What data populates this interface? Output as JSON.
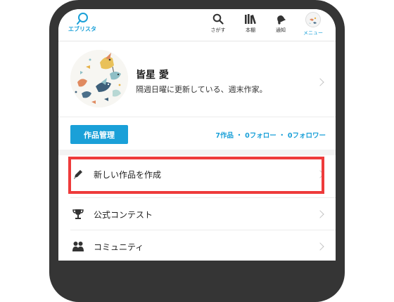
{
  "header": {
    "logo_label": "エブリスタ",
    "nav": [
      {
        "label": "さがす",
        "icon": "search-icon"
      },
      {
        "label": "本棚",
        "icon": "bookshelf-icon"
      },
      {
        "label": "通知",
        "icon": "bell-icon"
      },
      {
        "label": "メニュー",
        "icon": "avatar-icon"
      }
    ]
  },
  "profile": {
    "name": "皆星 愛",
    "bio": "隔週日曜に更新している、週末作家。"
  },
  "manage": {
    "button_label": "作品管理",
    "stats": {
      "works": "7作品",
      "sep1": "・",
      "following": "0フォロー",
      "sep2": "・",
      "followers": "0フォロワー"
    }
  },
  "menu": [
    {
      "label": "新しい作品を作成",
      "icon": "pencil-icon"
    },
    {
      "label": "公式コンテスト",
      "icon": "trophy-icon"
    },
    {
      "label": "コミュニティ",
      "icon": "people-icon"
    }
  ],
  "colors": {
    "accent": "#1aa0d8",
    "highlight": "#ee3b3b",
    "frame": "#353535"
  }
}
